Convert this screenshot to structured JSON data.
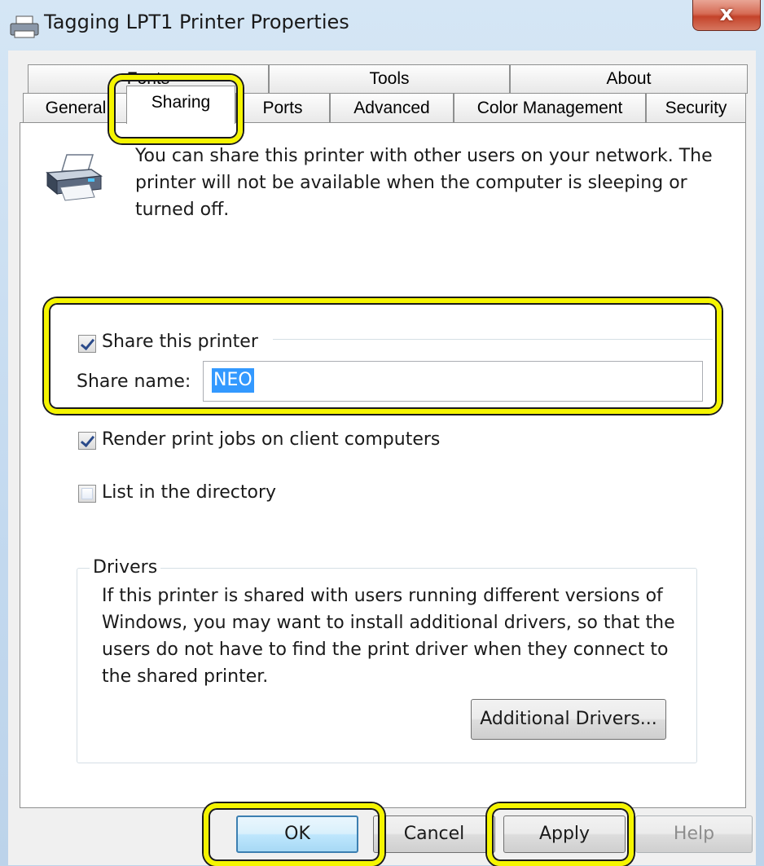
{
  "window": {
    "title": "Tagging LPT1 Printer Properties",
    "close_label": "x"
  },
  "tabs_row1": [
    {
      "label": "Fonts"
    },
    {
      "label": "Tools"
    },
    {
      "label": "About"
    }
  ],
  "tabs_row2": [
    {
      "label": "General"
    },
    {
      "label": "Sharing",
      "selected": true
    },
    {
      "label": "Ports"
    },
    {
      "label": "Advanced"
    },
    {
      "label": "Color Management"
    },
    {
      "label": "Security"
    }
  ],
  "sharing": {
    "info_text": "You can share this printer with other users on your network. The printer will not be available when the computer is sleeping or turned off.",
    "share_printer_label": "Share this printer",
    "share_printer_checked": true,
    "share_name_label": "Share name:",
    "share_name_value": "NEO",
    "render_jobs_label": "Render print jobs on client computers",
    "render_jobs_checked": true,
    "list_directory_label": "List in the directory",
    "list_directory_checked": false
  },
  "drivers": {
    "legend": "Drivers",
    "text": "If this printer is shared with users running different versions of Windows, you may want to install additional drivers, so that the users do not have to find the print driver when they connect to the shared printer.",
    "button_label": "Additional Drivers..."
  },
  "footer": {
    "ok_label": "OK",
    "cancel_label": "Cancel",
    "apply_label": "Apply",
    "help_label": "Help"
  },
  "colors": {
    "highlight": "#f5f500",
    "selection": "#3399ff",
    "close_button": "#c4432a"
  }
}
